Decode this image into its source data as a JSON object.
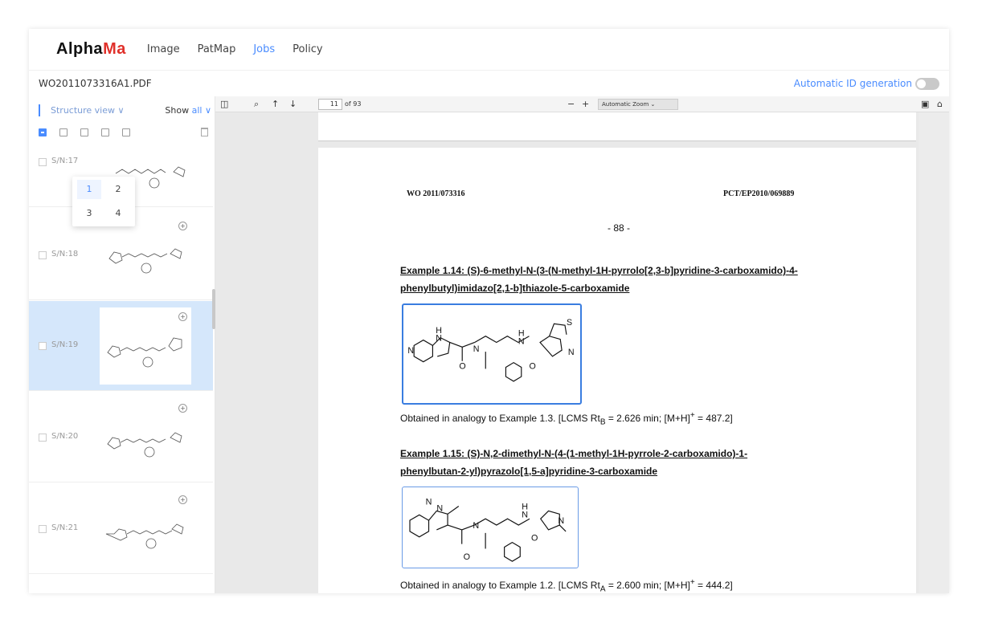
{
  "logo": {
    "part1": "Alpha",
    "part2": "Ma"
  },
  "nav": [
    "Image",
    "PatMap",
    "Jobs",
    "Policy"
  ],
  "nav_active": "Jobs",
  "file": {
    "name": "WO2011073316A1.PDF",
    "auto_id_label": "Automatic ID generation"
  },
  "sidebar": {
    "view_label": "Structure view ∨",
    "show_prefix": "Show",
    "show_value": "all ∨",
    "popup_options": [
      "1",
      "2",
      "3",
      "4"
    ],
    "cards": [
      {
        "sn": "S/N:17"
      },
      {
        "sn": "S/N:18"
      },
      {
        "sn": "S/N:19",
        "selected": true
      },
      {
        "sn": "S/N:20"
      },
      {
        "sn": "S/N:21"
      }
    ]
  },
  "viewer": {
    "page_input": "11",
    "of_pages": "of 93",
    "zoom": "Automatic Zoom"
  },
  "page": {
    "header_left": "WO 2011/073316",
    "header_right": "PCT/EP2010/069889",
    "page_number": "- 88 -",
    "examples": [
      {
        "title_line1": "Example 1.14: (S)-6-methyl-N-(3-(N-methyl-1H-pyrrolo[2,3-b]pyridine-3-carboxamido)-4-",
        "title_line2": "phenylbutyl)imidazo[2,1-b]thiazole-5-carboxamide",
        "note": "Obtained in analogy to Example 1.3. [LCMS Rt",
        "note_sub": "B",
        "note_mid": " = 2.626 min; [M+H]",
        "note_sup": "+",
        "note_end": " = 487.2]"
      },
      {
        "title_line1": "Example 1.15: (S)-N,2-dimethyl-N-(4-(1-methyl-1H-pyrrole-2-carboxamido)-1-",
        "title_line2": "phenylbutan-2-yl)pyrazolo[1,5-a]pyridine-3-carboxamide",
        "note": "Obtained in analogy to Example 1.2. [LCMS Rt",
        "note_sub": "A",
        "note_mid": " = 2.600 min; [M+H]",
        "note_sup": "+",
        "note_end": " = 444.2]"
      }
    ]
  },
  "colors": {
    "accent": "#4a8cff",
    "logo_red": "#e0312b",
    "selected_bg": "#d5e7fb"
  }
}
